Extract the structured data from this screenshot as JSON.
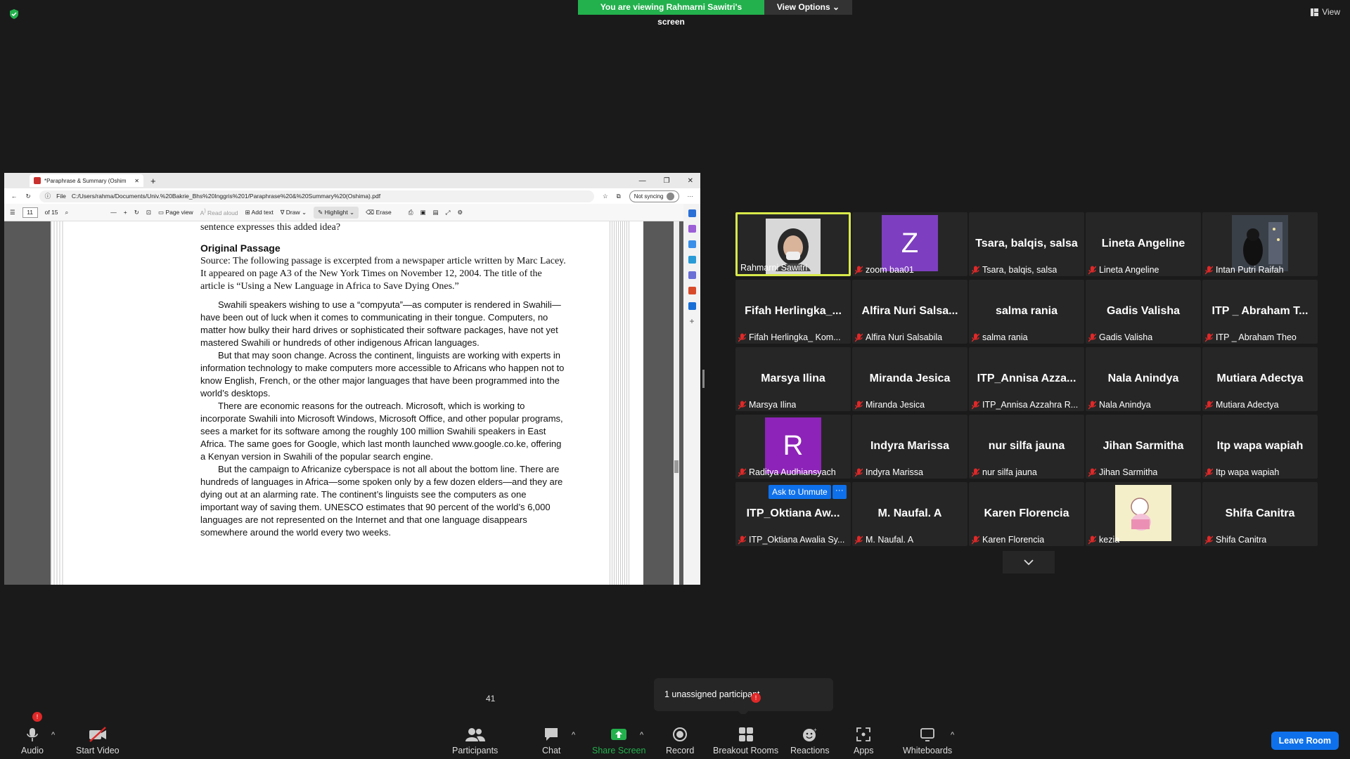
{
  "colors": {
    "banner_green": "#23b14d",
    "active_speaker": "#d8e94a",
    "leave": "#0e71eb",
    "muted_red": "#e02828"
  },
  "top": {
    "banner": "You are viewing Rahmarni Sawitri's screen",
    "view_options": "View Options",
    "view": "View"
  },
  "browser": {
    "tab_title": "*Paraphrase & Summary (Oshim",
    "file_label": "File",
    "url": "C:/Users/rahma/Documents/Univ.%20Bakrie_Bhs%20Inggris%201/Paraphrase%20&%20Summary%20(Oshima).pdf",
    "sync": "Not syncing",
    "page_num": "11",
    "page_total": "of 15",
    "page_view": "Page view",
    "read_aloud": "Read aloud",
    "add_text": "Add text",
    "draw": "Draw",
    "highlight": "Highlight",
    "erase": "Erase"
  },
  "doc": {
    "cut_line": "sentence expresses this added idea?",
    "heading": "Original Passage",
    "source": "Source: The following passage is excerpted from a newspaper article written by Marc Lacey. It appeared on page A3 of the New York Times on November 12, 2004. The title of the article is “Using a New Language in Africa to Save Dying Ones.”",
    "p1": "Swahili speakers wishing to use a “compyuta”—as computer is rendered in Swahili—have been out of luck when it comes to communicating in their tongue. Computers, no matter how bulky their hard drives or sophisticated their software packages, have not yet mastered Swahili or hundreds of other indigenous African languages.",
    "p2": "But that may soon change. Across the continent, linguists are working with experts in information technology to make computers more accessible to Africans who happen not to know English, French, or the other major languages that have been programmed into the world’s desktops.",
    "p3": "There are economic reasons for the outreach. Microsoft, which is working to incorporate Swahili into Microsoft Windows, Microsoft Office, and other popular programs, sees a market for its software among the roughly 100 million Swahili speakers in East Africa. The same goes for Google, which last month launched www.google.co.ke, offering a Kenyan version in Swahili of the popular search engine.",
    "p4": "But the campaign to Africanize cyberspace is not all about the bottom line. There are hundreds of languages in Africa—some spoken only by a few dozen elders—and they are dying out at an alarming rate. The continent’s linguists see the computers as one important way of saving them. UNESCO estimates that 90 percent of the world’s 6,000 languages are not represented on the Internet and that one language disappears somewhere around the world every two weeks."
  },
  "tiles": [
    {
      "big": "",
      "label": "Rahmarni Sawitri",
      "video": "photo",
      "active": true,
      "muted": false
    },
    {
      "big": "",
      "label": "zoom baa01",
      "avatar": "Z",
      "avatar_color": "#7d3fbf",
      "muted": true
    },
    {
      "big": "Tsara, balqis, salsa",
      "label": "Tsara, balqis, salsa",
      "muted": true
    },
    {
      "big": "Lineta Angeline",
      "label": "Lineta Angeline",
      "muted": true
    },
    {
      "big": "",
      "label": "Intan Putri Raifah",
      "video": "dark",
      "muted": true
    },
    {
      "big": "Fifah  Herlingka_...",
      "label": "Fifah Herlingka_ Kom...",
      "muted": true
    },
    {
      "big": "Alfira  Nuri  Salsa...",
      "label": "Alfira Nuri Salsabila",
      "muted": true
    },
    {
      "big": "salma rania",
      "label": "salma rania",
      "muted": true
    },
    {
      "big": "Gadis Valisha",
      "label": "Gadis Valisha",
      "muted": true
    },
    {
      "big": "ITP _ Abraham  T...",
      "label": "ITP _ Abraham Theo",
      "muted": true
    },
    {
      "big": "Marsya Ilina",
      "label": "Marsya Ilina",
      "muted": true
    },
    {
      "big": "Miranda Jesica",
      "label": "Miranda Jesica",
      "muted": true
    },
    {
      "big": "ITP_Annisa  Azza...",
      "label": "ITP_Annisa Azzahra R...",
      "muted": true
    },
    {
      "big": "Nala Anindya",
      "label": "Nala Anindya",
      "muted": true
    },
    {
      "big": "Mutiara Adectya",
      "label": "Mutiara Adectya",
      "muted": true
    },
    {
      "big": "",
      "label": "Raditya Audhiansyach",
      "avatar": "R",
      "avatar_color": "#8d23b8",
      "muted": true
    },
    {
      "big": "Indyra Marissa",
      "label": "Indyra Marissa",
      "muted": true
    },
    {
      "big": "nur silfa jauna",
      "label": "nur silfa jauna",
      "muted": true
    },
    {
      "big": "Jihan Sarmitha",
      "label": "Jihan Sarmitha",
      "muted": true
    },
    {
      "big": "Itp wapa wapiah",
      "label": "Itp wapa wapiah",
      "muted": true
    },
    {
      "big": "ITP_Oktiana  Aw...",
      "label": "ITP_Oktiana Awalia Sy...",
      "muted": true
    },
    {
      "big": "M. Naufal. A",
      "label": "M. Naufal. A",
      "muted": true
    },
    {
      "big": "Karen Florencia",
      "label": "Karen Florencia",
      "muted": true
    },
    {
      "big": "",
      "label": "kezia",
      "video": "cartoon",
      "muted": true
    },
    {
      "big": "Shifa Canitra",
      "label": "Shifa Canitra",
      "muted": true
    }
  ],
  "ask_to_unmute": "Ask to Unmute",
  "more_dots": "···",
  "tooltip": "1 unassigned participant",
  "toolbar": {
    "audio": "Audio",
    "audio_badge": "!",
    "start_video": "Start Video",
    "participants": "Participants",
    "participants_count": "41",
    "chat": "Chat",
    "share_screen": "Share Screen",
    "record": "Record",
    "breakout": "Breakout Rooms",
    "breakout_badge": "!",
    "reactions": "Reactions",
    "apps": "Apps",
    "whiteboards": "Whiteboards",
    "leave": "Leave Room"
  }
}
